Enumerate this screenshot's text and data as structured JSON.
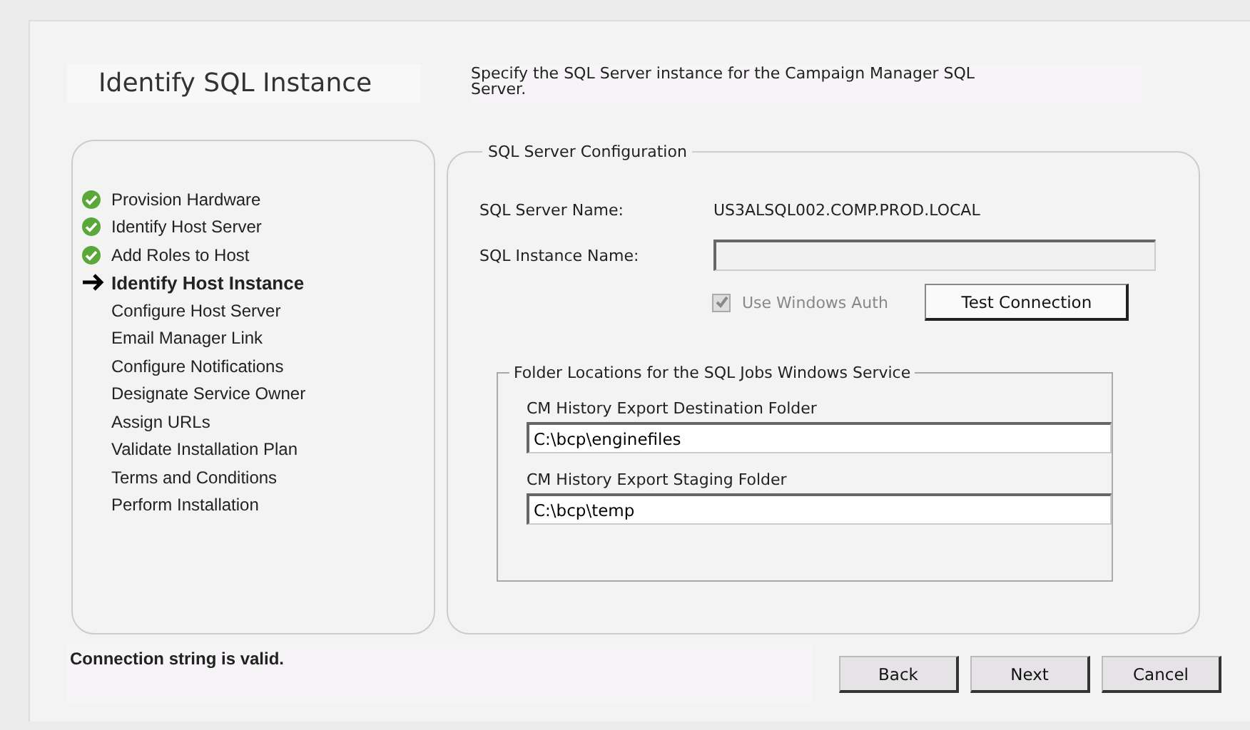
{
  "header": {
    "title": "Identify SQL Instance",
    "description": "Specify the SQL Server instance for the Campaign Manager SQL Server."
  },
  "steps": [
    {
      "label": "Provision Hardware",
      "kind": "done"
    },
    {
      "label": "Identify Host Server",
      "kind": "done"
    },
    {
      "label": "Add Roles to Host",
      "kind": "done"
    },
    {
      "label": "Identify Host Instance",
      "kind": "current"
    },
    {
      "label": "Configure Host Server",
      "kind": "pending"
    },
    {
      "label": "Email Manager Link",
      "kind": "pending"
    },
    {
      "label": "Configure Notifications",
      "kind": "pending"
    },
    {
      "label": "Designate Service Owner",
      "kind": "pending"
    },
    {
      "label": "Assign URLs",
      "kind": "pending"
    },
    {
      "label": "Validate Installation Plan",
      "kind": "pending"
    },
    {
      "label": "Terms and Conditions",
      "kind": "pending"
    },
    {
      "label": "Perform Installation",
      "kind": "pending"
    }
  ],
  "sql_config": {
    "legend": "SQL Server Configuration",
    "server_name_label": "SQL Server Name:",
    "server_name": "US3ALSQL002.COMP.PROD.LOCAL",
    "instance_label": "SQL Instance Name:",
    "windows_auth": {
      "label": "Use Windows Auth",
      "checked": true,
      "disabled": true
    },
    "test_button": "Test Connection"
  },
  "folders": {
    "legend": "Folder Locations for the SQL Jobs Windows Service",
    "fields": [
      {
        "label": "CM History Export Destination Folder",
        "value": "C:\\bcp\\enginefiles"
      },
      {
        "label": "CM History Export Staging Folder",
        "value": "C:\\bcp\\temp"
      }
    ]
  },
  "status": "Connection string is valid.",
  "buttons": [
    "Back",
    "Next",
    "Cancel"
  ]
}
